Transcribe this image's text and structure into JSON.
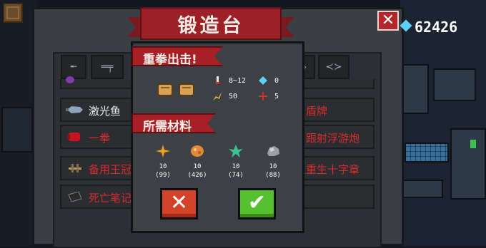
{
  "title": "锻造台",
  "gem_count": "62426",
  "icons": {
    "close": "close-icon",
    "gem": "gem-icon",
    "cancel": "cancel-icon",
    "confirm": "check-icon"
  },
  "tabs": [
    "ak-rifle-icon",
    "sniper-icon",
    "smg-icon",
    "shuriken-icon",
    "fish-icon"
  ],
  "weapon_list": {
    "left": [
      {
        "label": "激光鱼",
        "color": "#e9e9e9",
        "icon": "laser-fish-icon"
      },
      {
        "label": "一拳",
        "color": "#d52d2d",
        "icon": "fist-icon"
      },
      {
        "label": "备用王冠",
        "color": "#d52d2d",
        "icon": "crown-icon"
      },
      {
        "label": "死亡笔记",
        "color": "#d52d2d",
        "icon": "death-note-icon"
      }
    ],
    "right": [
      {
        "label": "盾牌",
        "color": "#d52d2d"
      },
      {
        "label": "跟射浮游炮",
        "color": "#d52d2d"
      },
      {
        "label": "重生十字章",
        "color": "#d52d2d"
      }
    ]
  },
  "recipe": {
    "weapon_name": "重拳出击!",
    "stats": {
      "damage": "8~12",
      "energy": "0",
      "crit": "50",
      "accuracy": "5"
    },
    "materials_title": "所需材料",
    "materials": [
      {
        "icon": "spark-fragment-icon",
        "required": "10",
        "owned": "(99)",
        "color": "#f0a020"
      },
      {
        "icon": "orange-ore-icon",
        "required": "10",
        "owned": "(426)",
        "color": "#e08a3a"
      },
      {
        "icon": "green-crystal-icon",
        "required": "10",
        "owned": "(74)",
        "color": "#3fbf8f"
      },
      {
        "icon": "iron-ore-icon",
        "required": "10",
        "owned": "(88)",
        "color": "#9aa0a6"
      }
    ]
  }
}
